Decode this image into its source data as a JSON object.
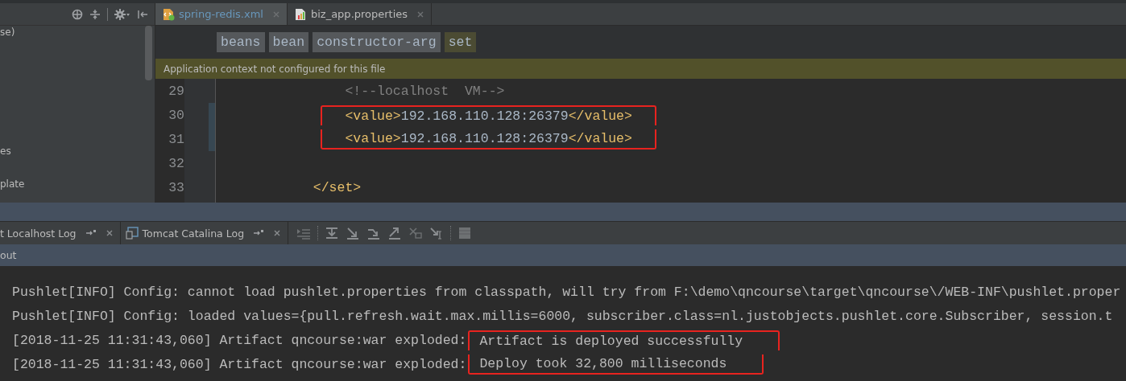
{
  "project_panel": {
    "items": [
      "se)",
      "es",
      "plate"
    ]
  },
  "editor": {
    "tabs": [
      {
        "label": "spring-redis.xml",
        "selected": true,
        "kind": "xml"
      },
      {
        "label": "biz_app.properties",
        "selected": false,
        "kind": "properties"
      }
    ],
    "breadcrumbs": [
      {
        "label": "beans",
        "selected": false
      },
      {
        "label": "bean",
        "selected": false
      },
      {
        "label": "constructor-arg",
        "selected": false
      },
      {
        "label": "set",
        "selected": true
      }
    ],
    "banner": "Application context not configured for this file",
    "lines": [
      {
        "number": "29",
        "highlighted": false,
        "changed": false,
        "segments": [
          {
            "kind": "comment",
            "text": "<!--localhost  VM-->"
          }
        ]
      },
      {
        "number": "30",
        "highlighted": true,
        "changed": true,
        "segments": [
          {
            "kind": "tag",
            "text": "<value>"
          },
          {
            "kind": "text",
            "text": "192.168.110.128:26379"
          },
          {
            "kind": "tag",
            "text": "</value>"
          }
        ]
      },
      {
        "number": "31",
        "highlighted": true,
        "changed": true,
        "segments": [
          {
            "kind": "tag",
            "text": "<value>"
          },
          {
            "kind": "text",
            "text": "192.168.110.128:26379"
          },
          {
            "kind": "tag",
            "text": "</value>"
          }
        ]
      },
      {
        "number": "32",
        "highlighted": false,
        "changed": false
      },
      {
        "number": "33",
        "highlighted": false,
        "changed": false,
        "segments": [
          {
            "kind": "tag",
            "text": "</set>"
          }
        ]
      }
    ]
  },
  "run_panel": {
    "tabs": [
      {
        "label": "t Localhost Log",
        "selected": false
      },
      {
        "label": "Tomcat Catalina Log",
        "selected": false
      }
    ],
    "section": "out",
    "console": [
      {
        "prefix": "Pushlet[INFO] Config: cannot load pushlet.properties from classpath, will try from F:\\demo\\qncourse\\target\\qncourse\\/WEB-INF\\pushlet.proper",
        "highlighted": false
      },
      {
        "prefix": "Pushlet[INFO] Config: loaded values={pull.refresh.wait.max.millis=6000, subscriber.class=nl.justobjects.pushlet.core.Subscriber, session.t",
        "highlighted": false
      },
      {
        "prefix": "[2018-11-25 11:31:43,060] Artifact qncourse:war exploded:",
        "message": "Artifact is deployed successfully",
        "highlighted": true
      },
      {
        "prefix": "[2018-11-25 11:31:43,060] Artifact qncourse:war exploded:",
        "message": "Deploy took 32,800 milliseconds",
        "highlighted": true
      }
    ]
  }
}
